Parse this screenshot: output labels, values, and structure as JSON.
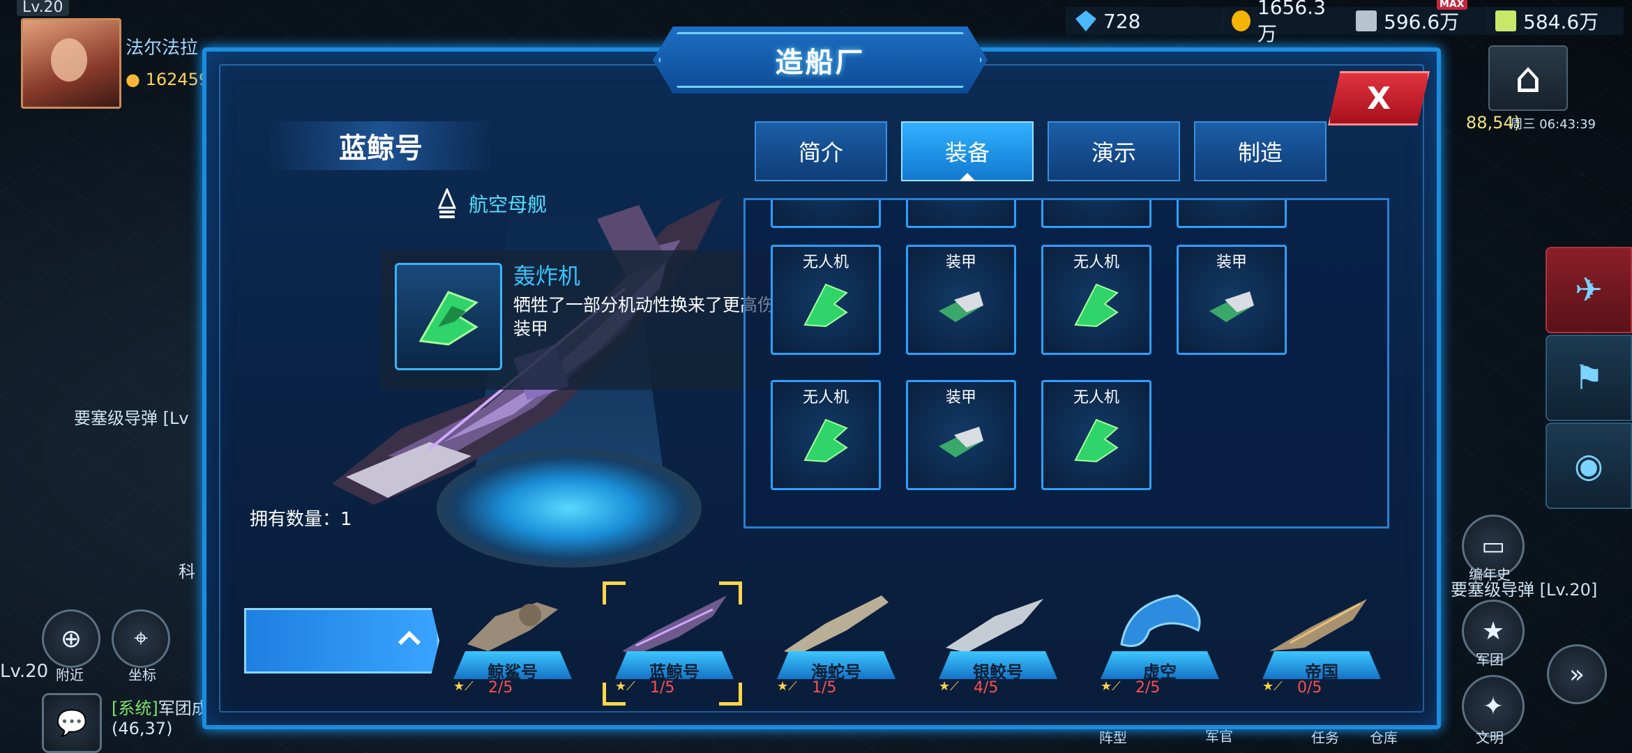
{
  "hud": {
    "level": "Lv.20",
    "player_name": "法尔法拉",
    "power": "162459",
    "resources": [
      {
        "icon": "diamond-icon",
        "value": "728",
        "color": "#4bb8ff"
      },
      {
        "icon": "gold-coin-icon",
        "value": "1656.3万",
        "color": "#f5b400"
      },
      {
        "icon": "metal-icon",
        "value": "596.6万",
        "color": "#b7c3cf"
      },
      {
        "icon": "crystal-icon",
        "value": "584.6万",
        "color": "#c8e86a"
      }
    ],
    "max_badge": "MAX",
    "coords_right": "88,54)",
    "time": "周三 06:43:39",
    "left_text": "要塞级导弹 [Lv",
    "right_text": "要塞级导弹 [Lv.20]",
    "lv_bottom": "Lv.20",
    "nearby": "附近",
    "marker": "坐标",
    "sci": "科",
    "chronicle": "编年史",
    "legion": "军团",
    "formation": "阵型",
    "officer": "军官",
    "task": "任务",
    "warehouse": "仓库",
    "civilization": "文明",
    "chat_tag": "[系统]",
    "chat_text": "军团成",
    "chat_coords": "(46,37)"
  },
  "window": {
    "title": "造船厂",
    "close_label": "X",
    "ship_name": "蓝鲸号",
    "ship_class": "航空母舰",
    "owned_label": "拥有数量：",
    "owned_value": "1"
  },
  "tooltip": {
    "title": "轰炸机",
    "description": "牺牲了一部分机动性换来了更高伤害和更高装甲"
  },
  "tabs": [
    {
      "label": "简介",
      "active": false
    },
    {
      "label": "装备",
      "active": true
    },
    {
      "label": "演示",
      "active": false
    },
    {
      "label": "制造",
      "active": false
    }
  ],
  "equipment": [
    {
      "label": "无人机",
      "type": "drone"
    },
    {
      "label": "装甲",
      "type": "armor"
    },
    {
      "label": "无人机",
      "type": "drone"
    },
    {
      "label": "装甲",
      "type": "armor"
    },
    {
      "label": "无人机",
      "type": "drone"
    },
    {
      "label": "装甲",
      "type": "armor"
    },
    {
      "label": "无人机",
      "type": "drone"
    }
  ],
  "ships": [
    {
      "name": "鲸鲨号",
      "count": "2/5",
      "selected": false
    },
    {
      "name": "蓝鲸号",
      "count": "1/5",
      "selected": true
    },
    {
      "name": "海蛇号",
      "count": "1/5",
      "selected": false
    },
    {
      "name": "银鲛号",
      "count": "4/5",
      "selected": false
    },
    {
      "name": "虚空",
      "count": "2/5",
      "selected": false
    },
    {
      "name": "帝国",
      "count": "0/5",
      "selected": false
    }
  ]
}
